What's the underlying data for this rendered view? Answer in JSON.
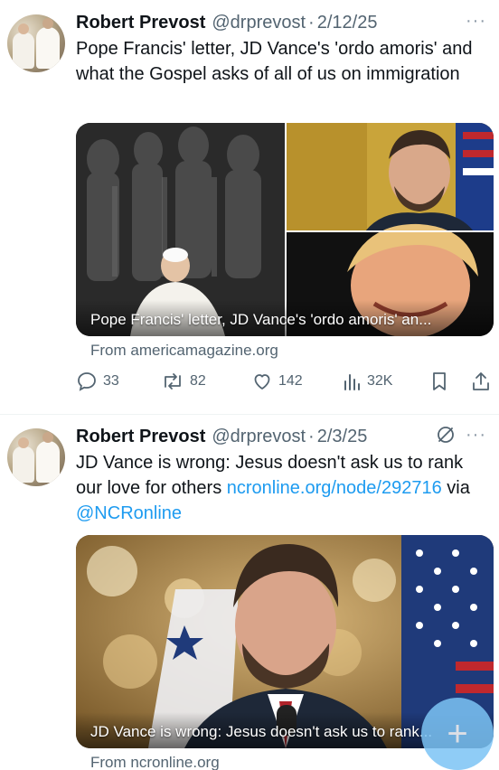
{
  "tweets": [
    {
      "name": "Robert Prevost",
      "handle": "@drprevost",
      "date": "2/12/25",
      "more": "···",
      "text": "Pope Francis' letter, JD Vance's 'ordo amoris' and what the Gospel asks of all of us on immigration",
      "card_caption": "Pope Francis' letter, JD Vance's 'ordo amoris' an...",
      "source": "From americamagazine.org",
      "actions": {
        "replies": "33",
        "reposts": "82",
        "likes": "142",
        "views": "32K"
      }
    },
    {
      "name": "Robert Prevost",
      "handle": "@drprevost",
      "date": "2/3/25",
      "more": "···",
      "text_plain_1": "JD Vance is wrong: Jesus doesn't ask us to rank our love for others ",
      "text_link_1": "ncronline.org/node/292716",
      "text_plain_2": " via ",
      "text_link_2": "@NCRonline",
      "card_caption": "JD Vance is wrong: Jesus doesn't ask us to rank...",
      "source": "From ncronline.org"
    }
  ],
  "icons": {
    "reply": "reply-icon",
    "repost": "repost-icon",
    "like": "heart-icon",
    "views": "analytics-icon",
    "bookmark": "bookmark-icon",
    "share": "share-icon",
    "grok": "grok-icon",
    "compose": "compose-plus-icon"
  },
  "colors": {
    "link": "#1d9bf0",
    "secondary_text": "#536471",
    "primary_text": "#0f1419"
  },
  "fab": {
    "label": "+"
  }
}
